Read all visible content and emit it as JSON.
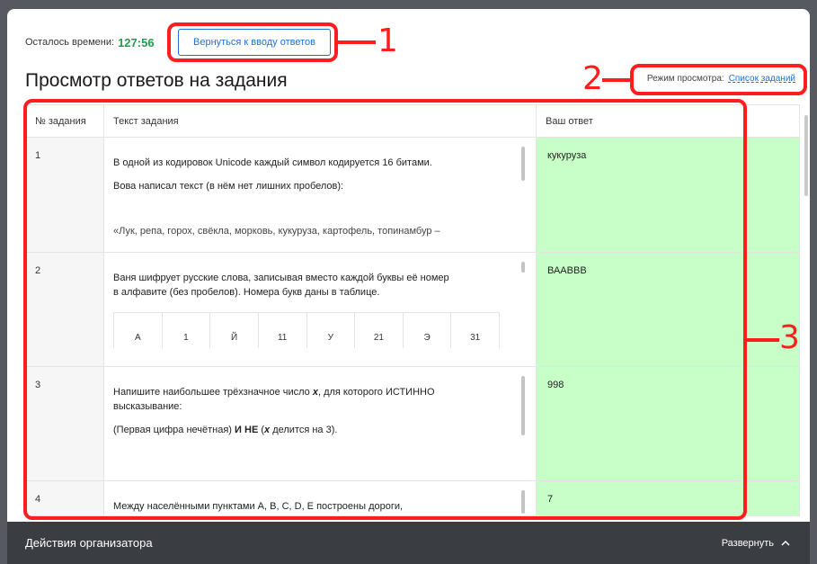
{
  "timer": {
    "label": "Осталось времени:",
    "value": "127:56"
  },
  "back_button": {
    "label": "Вернуться к вводу ответов"
  },
  "page_title": "Просмотр ответов на задания",
  "view_mode": {
    "label": "Режим просмотра:",
    "link": "Список заданий"
  },
  "table": {
    "headers": {
      "num": "№ задания",
      "text": "Текст задания",
      "answer": "Ваш ответ"
    },
    "rows": [
      {
        "num": "1",
        "lines": [
          "В одной из кодировок Unicode каждый символ кодируется 16 битами.",
          "Вова написал текст (в нём нет лишних пробелов):",
          "«Лук, репа, горох, свёкла, морковь, кукуруза, картофель, топинамбур –"
        ],
        "answer": "кукуруза"
      },
      {
        "num": "2",
        "lines": [
          "Ваня шифрует русские слова, записывая вместо каждой буквы её номер",
          "в алфавите (без пробелов). Номера букв даны в таблице."
        ],
        "letters": [
          "А",
          "1",
          "Й",
          "11",
          "У",
          "21",
          "Э",
          "31"
        ],
        "answer": "ВААВВВ"
      },
      {
        "num": "3",
        "line1_pre": "Напишите наибольшее трёхзначное число ",
        "line1_var": "x",
        "line1_post": ", для которого ИСТИННО высказывание:",
        "line2_pre": "(Первая цифра нечётная) ",
        "line2_bold": "И НЕ",
        "line2_mid": " (",
        "line2_var": "x",
        "line2_post": " делится на 3).",
        "answer": "998"
      },
      {
        "num": "4",
        "lines": [
          "Между населёнными пунктами A, B, C, D, E построены дороги,"
        ],
        "answer": "7"
      }
    ]
  },
  "footer": {
    "title": "Действия организатора",
    "expand_label": "Развернуть",
    "expand_icon": "chevron-up-icon"
  },
  "annotations": {
    "one": "1",
    "two": "2",
    "three": "3",
    "color": "#ff1d1d"
  }
}
